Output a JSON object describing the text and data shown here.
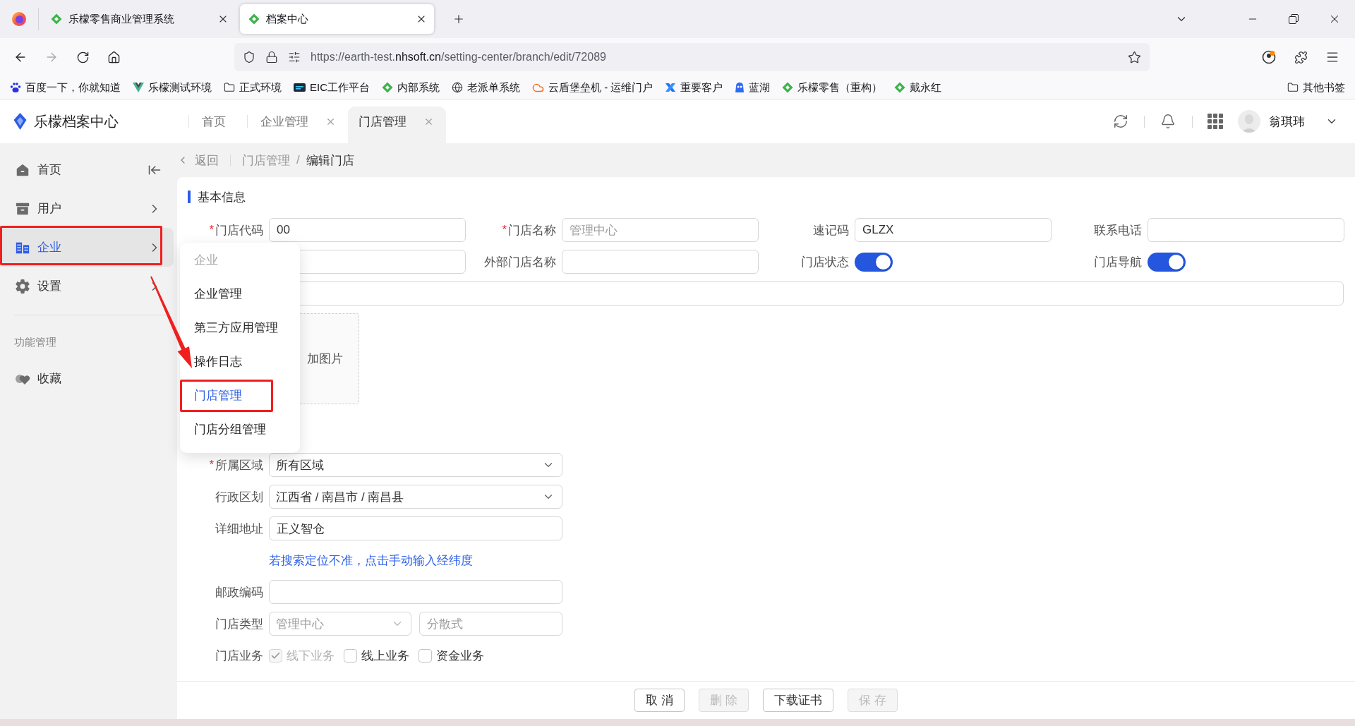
{
  "browser": {
    "tabs": [
      {
        "title": "乐檬零售商业管理系统",
        "selected": false
      },
      {
        "title": "档案中心",
        "selected": true
      }
    ],
    "address": {
      "url_prefix": "https://earth-test.",
      "url_domain": "nhsoft.cn",
      "url_path": "/setting-center/branch/edit/72089"
    },
    "bookmarks": [
      {
        "label": "百度一下，你就知道",
        "kind": "paw"
      },
      {
        "label": "乐檬测试环境",
        "kind": "vue"
      },
      {
        "label": "正式环境",
        "kind": "folder"
      },
      {
        "label": "EIC工作平台",
        "kind": "badge"
      },
      {
        "label": "内部系统",
        "kind": "leaf"
      },
      {
        "label": "老派单系统",
        "kind": "globe"
      },
      {
        "label": "云盾堡垒机 - 运维门户",
        "kind": "cloud"
      },
      {
        "label": "重要客户",
        "kind": "cross"
      },
      {
        "label": "蓝湖",
        "kind": "mascot"
      },
      {
        "label": "乐檬零售（重构）",
        "kind": "leaf"
      },
      {
        "label": "戴永红",
        "kind": "leaf"
      }
    ],
    "other_bookmarks": "其他书签"
  },
  "app_header": {
    "title": "乐檬档案中心",
    "tabs": [
      {
        "label": "首页",
        "selected": false,
        "closable": false
      },
      {
        "label": "企业管理",
        "selected": false,
        "closable": true
      },
      {
        "label": "门店管理",
        "selected": true,
        "closable": true
      }
    ],
    "user_name": "翁琪玮"
  },
  "sidebar": {
    "items": [
      {
        "label": "首页",
        "kind": "home",
        "selected": false,
        "expandable": false,
        "marked": false
      },
      {
        "label": "用户",
        "kind": "user",
        "selected": false,
        "expandable": true,
        "marked": false
      },
      {
        "label": "企业",
        "kind": "enterprise",
        "selected": true,
        "expandable": true,
        "marked": true
      },
      {
        "label": "设置",
        "kind": "settings",
        "selected": false,
        "expandable": true,
        "marked": false
      }
    ],
    "section_title": "功能管理",
    "section_items": [
      {
        "label": "收藏",
        "kind": "favorite",
        "selected": false,
        "expandable": false,
        "marked": false
      }
    ]
  },
  "breadcrumb": {
    "back": "返回",
    "trail": [
      {
        "label": "门店管理",
        "current": false
      },
      {
        "label": "编辑门店",
        "current": true
      }
    ],
    "separator": "/"
  },
  "form": {
    "section_title": "基本信息",
    "grid_rows": [
      [
        {
          "kind": "input",
          "label": "门店代码",
          "required_mark": "*",
          "value": "00",
          "disabled": false
        },
        {
          "kind": "input",
          "label": "门店名称",
          "required_mark": "*",
          "value": "管理中心",
          "disabled": true
        },
        {
          "kind": "input",
          "label": "速记码",
          "value": "GLZX",
          "disabled": false
        },
        {
          "kind": "input",
          "label": "联系电话"
        }
      ],
      [
        {
          "kind": "input"
        },
        {
          "kind": "input",
          "label": "外部门店名称"
        },
        {
          "kind": "switch",
          "label": "门店状态",
          "on": true
        },
        {
          "kind": "switch",
          "label": "门店导航",
          "on": true
        }
      ],
      [
        {
          "kind": "wide_input"
        }
      ],
      [
        {
          "kind": "upload",
          "text": "加图片"
        }
      ]
    ],
    "rows": [
      {
        "kind": "select",
        "label": "所属区域",
        "required_mark": "*",
        "value": "所有区域",
        "disabled": false
      },
      {
        "kind": "select",
        "label": "行政区划",
        "value": "江西省 / 南昌市 / 南昌县",
        "disabled": false
      },
      {
        "kind": "input",
        "label": "详细地址",
        "value": "正义智仓",
        "disabled": false
      },
      {
        "kind": "link",
        "text": "若搜索定位不准，点击手动输入经纬度"
      },
      {
        "kind": "input",
        "label": "邮政编码"
      },
      {
        "kind": "select_input",
        "label": "门店类型",
        "select": {
          "value": "管理中心",
          "disabled": true
        },
        "input": {
          "value": "分散式",
          "disabled": true
        }
      },
      {
        "kind": "checkboxes",
        "label": "门店业务",
        "options": [
          {
            "label": "线下业务",
            "checked": true,
            "disabled": true
          },
          {
            "label": "线上业务",
            "checked": false,
            "disabled": false
          },
          {
            "label": "资金业务",
            "checked": false,
            "disabled": false
          }
        ]
      }
    ]
  },
  "flyout_menu": {
    "title": "企业",
    "items": [
      {
        "label": "企业管理",
        "selected": false,
        "marked": false
      },
      {
        "label": "第三方应用管理",
        "selected": false,
        "marked": false
      },
      {
        "label": "操作日志",
        "selected": false,
        "marked": false
      },
      {
        "label": "门店管理",
        "selected": true,
        "marked": true
      },
      {
        "label": "门店分组管理",
        "selected": false,
        "marked": false
      }
    ]
  },
  "footer": {
    "buttons": [
      {
        "label": "取 消",
        "disabled": false
      },
      {
        "label": "删 除",
        "disabled": true
      },
      {
        "label": "下载证书",
        "disabled": false
      },
      {
        "label": "保 存",
        "disabled": true
      }
    ]
  }
}
